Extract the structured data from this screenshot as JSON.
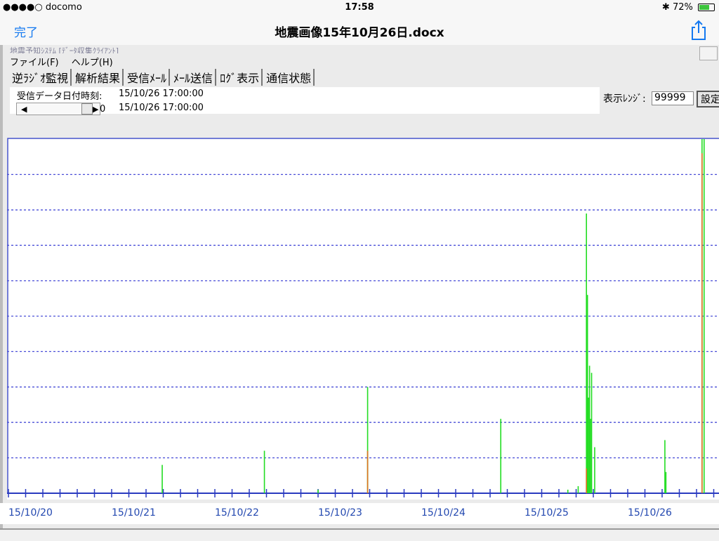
{
  "status": {
    "carrier": "●●●●○ docomo",
    "time": "17:58",
    "battery": "72%",
    "battery_level": 0.72
  },
  "nav": {
    "done_label": "完了",
    "title": "地震画像15年10月26日.docx"
  },
  "app": {
    "title": "地震予知ｼｽﾃﾑ [ﾃﾞｰﾀ収集ｸﾗｲｱﾝﾄ]",
    "menu": [
      "ファイル(F)",
      "ヘルプ(H)"
    ],
    "tabs": [
      "逆ﾗｼﾞｵ監視",
      "解析結果",
      "受信ﾒｰﾙ",
      "ﾒｰﾙ送信",
      "ﾛｸﾞ表示",
      "通信状態"
    ],
    "received_label": "受信データ日付時刻:",
    "received_value": "15/10/26 17:00:00",
    "slider_value": "0",
    "slider_date": "15/10/26 17:00:00",
    "range_label": "表示ﾚﾝｼﾞ:",
    "range_value": "99999",
    "set_button": "設定"
  },
  "chart_data": {
    "type": "bar",
    "x_tick_labels": [
      "15/10/20",
      "15/10/21",
      "15/10/22",
      "15/10/23",
      "15/10/24",
      "15/10/25",
      "15/10/26"
    ],
    "x_range_days": [
      0,
      6.9
    ],
    "ylim": [
      0,
      100
    ],
    "grid": "dashed horizontal",
    "series": [
      {
        "color": "#22dd22",
        "points": [
          [
            1.49,
            8
          ],
          [
            2.48,
            12
          ],
          [
            3.0,
            1
          ],
          [
            3.48,
            30
          ],
          [
            4.77,
            21
          ],
          [
            5.42,
            1
          ],
          [
            5.52,
            2
          ],
          [
            5.6,
            79
          ],
          [
            5.61,
            56
          ],
          [
            5.62,
            27
          ],
          [
            5.63,
            36
          ],
          [
            5.64,
            21
          ],
          [
            5.65,
            34
          ],
          [
            5.68,
            13
          ],
          [
            6.36,
            15
          ],
          [
            6.37,
            6
          ],
          [
            6.72,
            100
          ],
          [
            6.74,
            100
          ]
        ]
      },
      {
        "color": "#e07020",
        "points": [
          [
            3.48,
            12
          ],
          [
            5.6,
            7
          ],
          [
            6.72,
            96
          ]
        ]
      }
    ]
  }
}
